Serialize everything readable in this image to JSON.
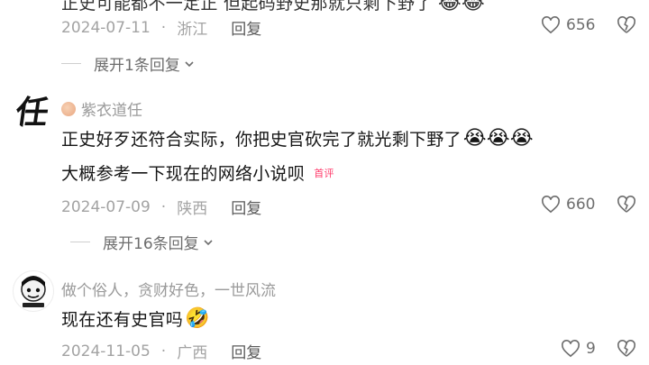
{
  "comments": [
    {
      "body_line_1": "正史可能都不一定正 但起码野史那就只剩下野了",
      "date": "2024-07-11",
      "region": "浙江",
      "reply_label": "回复",
      "likes": "656",
      "expand_label": "展开1条回复",
      "emojis": "😂😂"
    },
    {
      "avatar_char": "任",
      "username": "紫衣道任",
      "body_line_1": "正史好歹还符合实际，你把史官砍完了就光剩下野了",
      "body_emojis": "😭😭😭",
      "body_line_2": "大概参考一下现在的网络小说呗",
      "first_comment_tag": "首评",
      "date": "2024-07-09",
      "region": "陕西",
      "reply_label": "回复",
      "likes": "660",
      "expand_label": "展开16条回复"
    },
    {
      "username": "做个俗人，贪财好色，一世风流",
      "body_line_1": "现在还有史官吗",
      "body_emojis": "🤣",
      "date": "2024-11-05",
      "region": "广西",
      "reply_label": "回复",
      "likes": "9"
    }
  ],
  "icons": {
    "like": "heart-outline-icon",
    "dislike": "broken-heart-icon",
    "chevron": "chevron-down-icon"
  }
}
